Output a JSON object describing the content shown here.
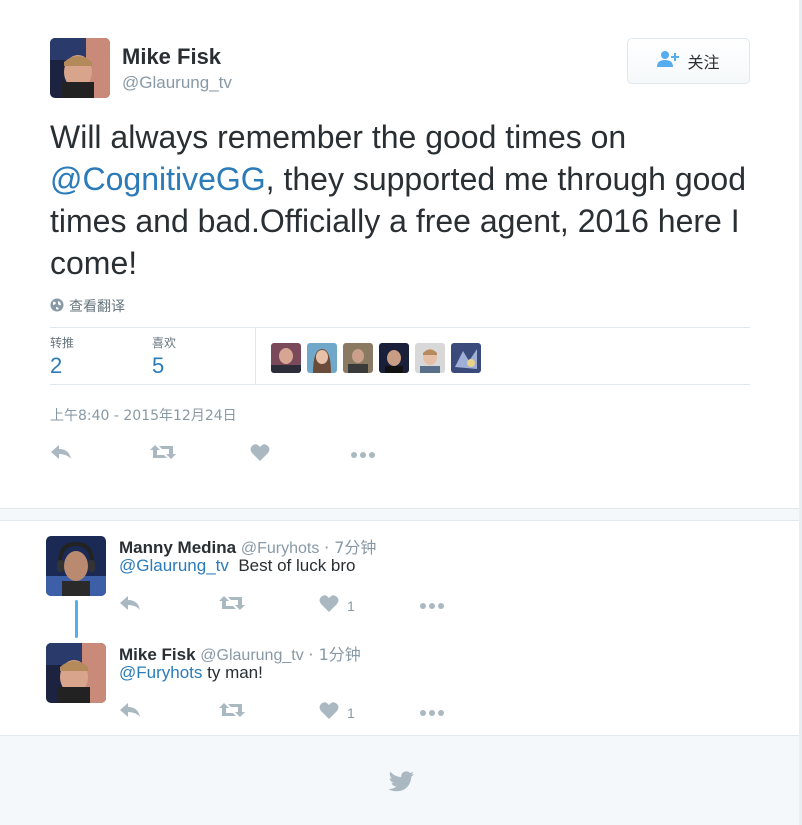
{
  "tweet": {
    "author_name": "Mike Fisk",
    "author_handle": "@Glaurung_tv",
    "follow_label": "关注",
    "text_line1": "Will always remember the good times on",
    "mention": "@CognitiveGG",
    "text_line2_rest": ", they supported me through good times and bad.Officially a free agent, 2016 here I come!",
    "translate_label": "查看翻译",
    "retweets_label": "转推",
    "retweets_count": "2",
    "likes_label": "喜欢",
    "likes_count": "5",
    "timestamp": "上午8:40 - 2015年12月24日"
  },
  "replies": [
    {
      "name": "Manny Medina",
      "handle": "@Furyhots",
      "time": "· 7分钟",
      "mention": "@Glaurung_tv",
      "text": "Best of luck bro",
      "like_count": "1"
    },
    {
      "name": "Mike Fisk",
      "handle": "@Glaurung_tv",
      "time": "· 1分钟",
      "mention": "@Furyhots",
      "text": "ty man!",
      "like_count": "1"
    }
  ],
  "icons": {
    "reply": "reply-icon",
    "retweet": "retweet-icon",
    "like": "heart-icon",
    "more": "more-icon",
    "globe": "globe-icon",
    "follow": "add-user-icon",
    "logo": "twitter-bird-icon"
  },
  "colors": {
    "link": "#2b7bb9",
    "accent": "#55acee",
    "muted": "#8899a6",
    "icon": "#aab8c2"
  }
}
